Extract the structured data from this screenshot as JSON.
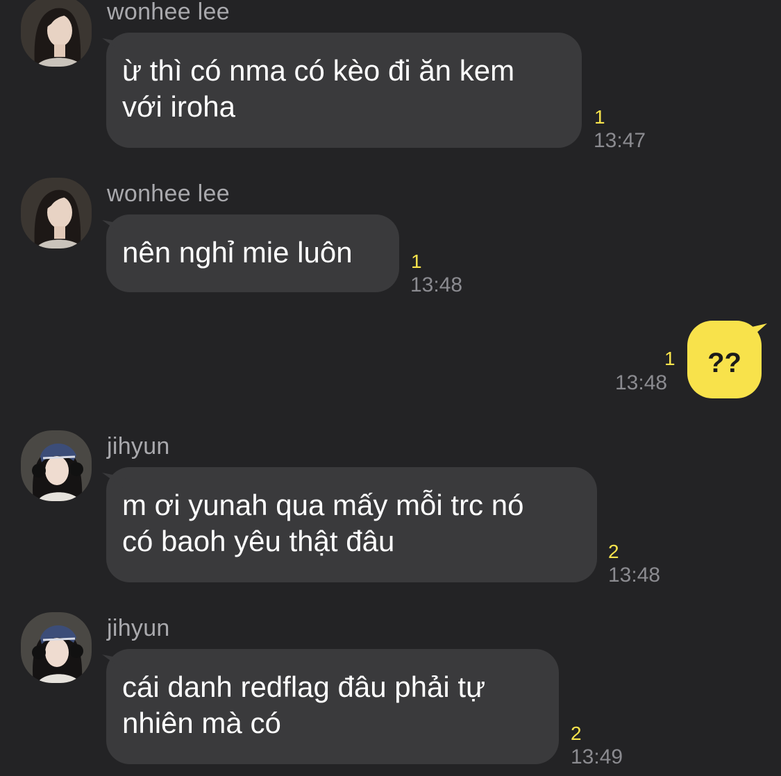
{
  "colors": {
    "background": "#232325",
    "incoming_bubble": "#3a3a3c",
    "outgoing_bubble": "#f8e24b",
    "unread_count": "#f7e34c",
    "timestamp": "#8b8b90",
    "sender_name": "#a9a9ad"
  },
  "messages": [
    {
      "sender": "wonhee lee",
      "avatar": "wonhee-avatar",
      "text": "ừ thì có nma có kèo đi ăn kem\nvới iroha",
      "unread": "1",
      "time": "13:47"
    },
    {
      "sender": "wonhee lee",
      "avatar": "wonhee-avatar",
      "text": "nên nghỉ mie luôn",
      "unread": "1",
      "time": "13:48"
    },
    {
      "sender": "me",
      "text": "??",
      "unread": "1",
      "time": "13:48"
    },
    {
      "sender": "jihyun",
      "avatar": "jihyun-avatar",
      "text": "m ơi yunah qua mấy mỗi trc nó\ncó baoh yêu thật đâu",
      "unread": "2",
      "time": "13:48"
    },
    {
      "sender": "jihyun",
      "avatar": "jihyun-avatar",
      "text": "cái danh redflag đâu phải tự\nnhiên mà có",
      "unread": "2",
      "time": "13:49"
    }
  ]
}
